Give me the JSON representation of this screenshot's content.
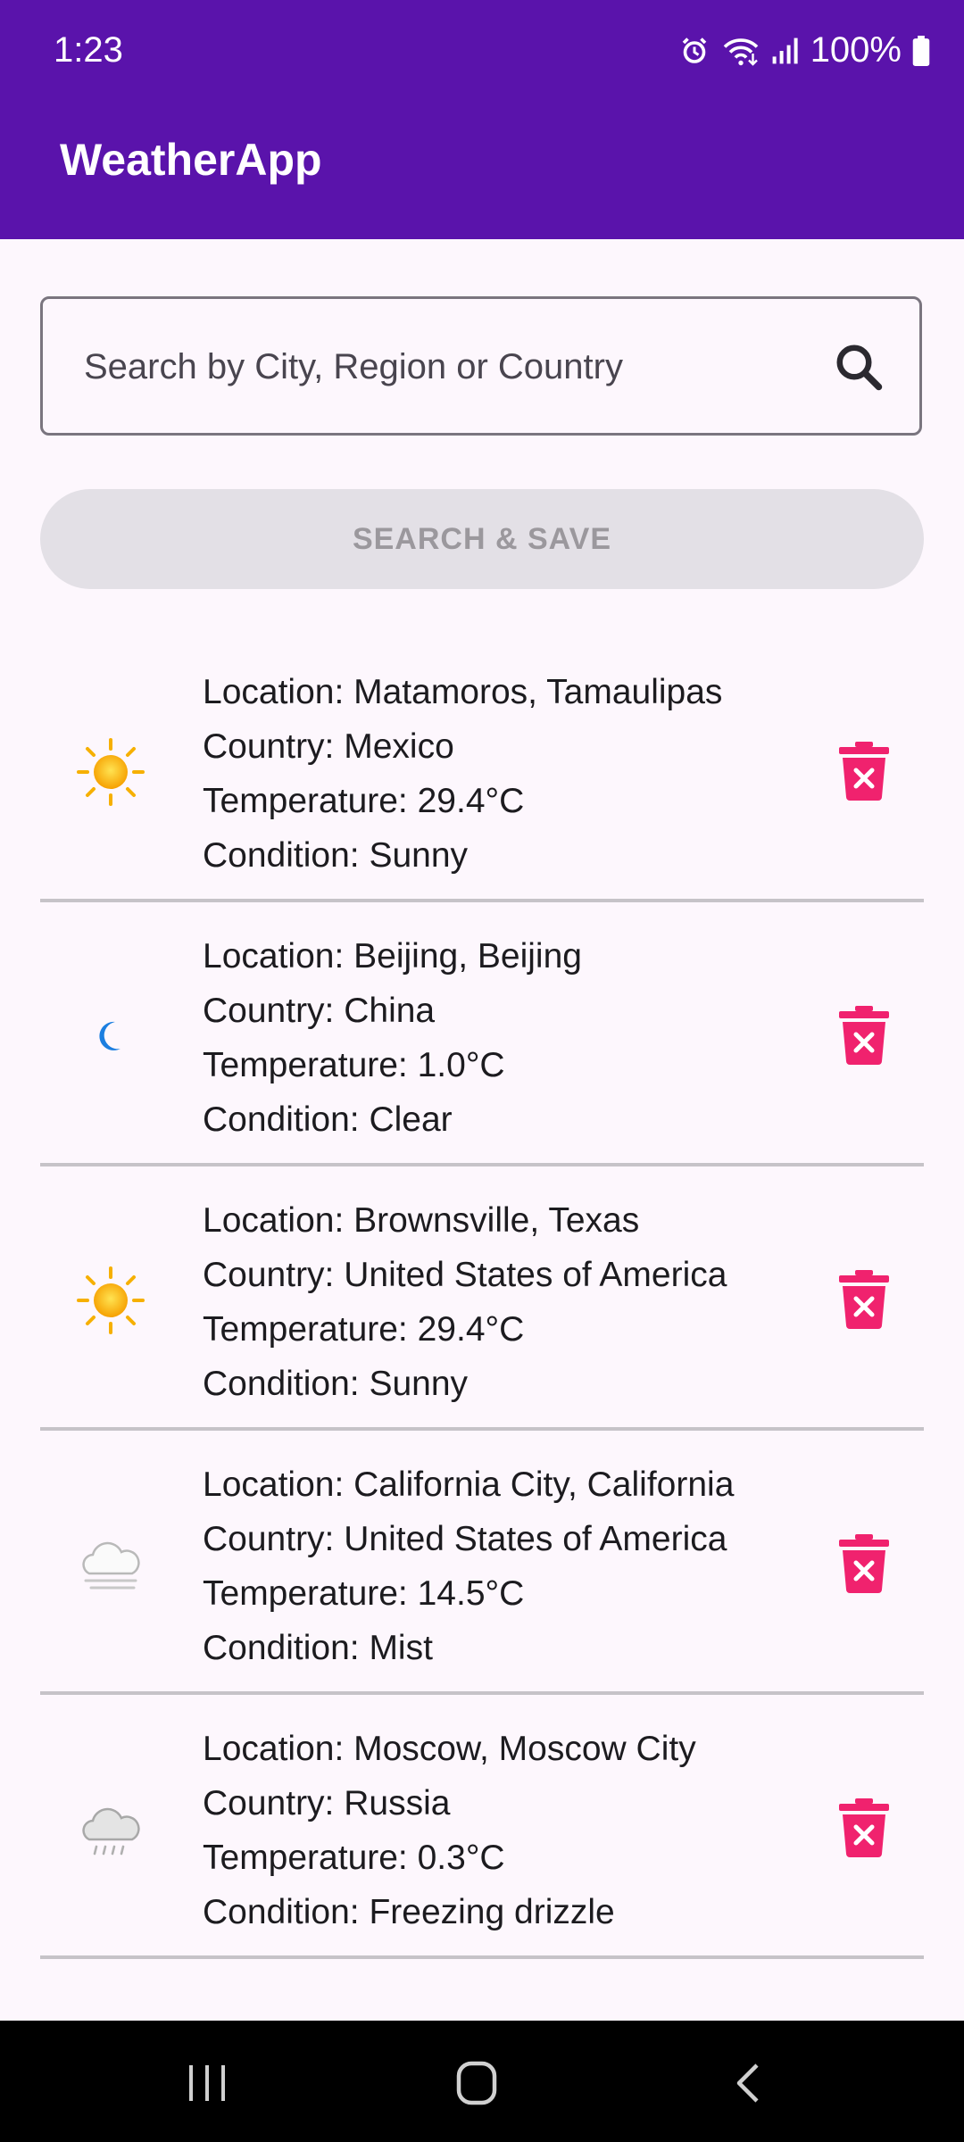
{
  "status_bar": {
    "time": "1:23",
    "battery": "100%",
    "icons": [
      "alarm-icon",
      "wifi-icon",
      "signal-icon",
      "battery-icon"
    ]
  },
  "app_bar": {
    "title": "WeatherApp"
  },
  "search": {
    "placeholder": "Search by City, Region or Country",
    "value": "",
    "button_label": "SEARCH & SAVE"
  },
  "colors": {
    "app_bar": "#5a13ab",
    "delete_icon": "#f0226e",
    "background": "#fdf7fd",
    "button_disabled_bg": "#e3e0e6"
  },
  "locations": [
    {
      "icon": "sun-icon",
      "location": "Location: Matamoros, Tamaulipas",
      "country": "Country: Mexico",
      "temperature": "Temperature: 29.4°C",
      "condition": "Condition: Sunny"
    },
    {
      "icon": "moon-icon",
      "location": "Location: Beijing, Beijing",
      "country": "Country: China",
      "temperature": "Temperature: 1.0°C",
      "condition": "Condition: Clear"
    },
    {
      "icon": "sun-icon",
      "location": "Location: Brownsville, Texas",
      "country": "Country: United States of America",
      "temperature": "Temperature: 29.4°C",
      "condition": "Condition: Sunny"
    },
    {
      "icon": "mist-icon",
      "location": "Location: California City, California",
      "country": "Country: United States of America",
      "temperature": "Temperature: 14.5°C",
      "condition": "Condition: Mist"
    },
    {
      "icon": "freezing-drizzle-icon",
      "location": "Location: Moscow, Moscow City",
      "country": "Country: Russia",
      "temperature": "Temperature: 0.3°C",
      "condition": "Condition: Freezing drizzle"
    }
  ],
  "nav_bar": {
    "buttons": [
      "recent-apps-icon",
      "home-icon",
      "back-icon"
    ]
  }
}
